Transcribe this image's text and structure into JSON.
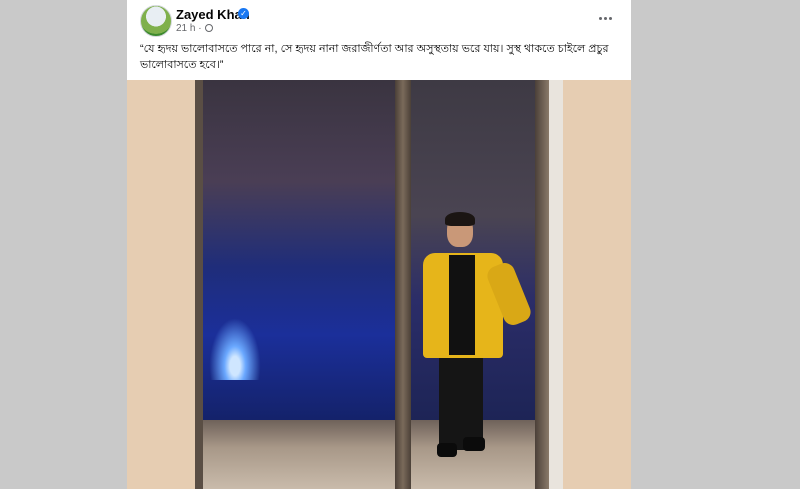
{
  "post": {
    "author": "Zayed Khan",
    "time": "21 h ·",
    "caption": "“যে হৃদয় ভালোবাসতে পারে না, সে হৃদয় নানা জরাজীর্ণতা আর অসুস্থতায় ভরে যায়। সুস্থ থাকতে চাইলে প্রচুর ভালোবাসতে হবে।”",
    "verified_mark": "✓",
    "icons": {
      "avatar": "profile-avatar",
      "verified": "verified-badge-icon",
      "audience": "globe-icon",
      "menu": "more-options-icon"
    }
  },
  "colors": {
    "verified": "#1877f2",
    "secondary_text": "#65676b",
    "page_bg": "#c9c9c9"
  }
}
